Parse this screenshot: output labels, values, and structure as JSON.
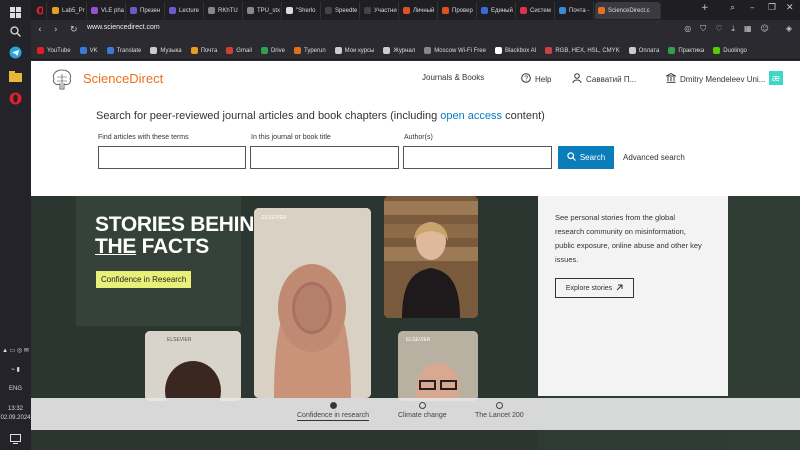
{
  "os": {
    "language": "ENG",
    "time": "13:32",
    "date": "02.09.2024"
  },
  "tabs": [
    {
      "label": "Lab5_Pr",
      "color": "#e0a020"
    },
    {
      "label": "VLE pha",
      "color": "#9a4fd0"
    },
    {
      "label": "Презен",
      "color": "#6a5acd"
    },
    {
      "label": "Lecture",
      "color": "#6a5acd"
    },
    {
      "label": "RKhTU",
      "color": "#888888"
    },
    {
      "label": "TPU_stx",
      "color": "#888888"
    },
    {
      "label": "\"Sherlo",
      "color": "#dddddd"
    },
    {
      "label": "Speedte",
      "color": "#444444"
    },
    {
      "label": "Участни",
      "color": "#444444"
    },
    {
      "label": "Личный",
      "color": "#e05020"
    },
    {
      "label": "Провер",
      "color": "#e05020"
    },
    {
      "label": "Единый",
      "color": "#3a6ad0"
    },
    {
      "label": "Систем",
      "color": "#e03050"
    },
    {
      "label": "Почта -",
      "color": "#3a8ad0"
    },
    {
      "label": "ScienceDirect.c",
      "color": "#e9711c"
    }
  ],
  "address": {
    "url": "www.sciencedirect.com"
  },
  "bookmarks": [
    {
      "label": "YouTube",
      "color": "#e02020"
    },
    {
      "label": "VK",
      "color": "#3a7ad0"
    },
    {
      "label": "Translate",
      "color": "#3a7ad0"
    },
    {
      "label": "Музыка",
      "color": "#cccccc"
    },
    {
      "label": "Почта",
      "color": "#e0a020"
    },
    {
      "label": "Gmail",
      "color": "#d04030"
    },
    {
      "label": "Drive",
      "color": "#30a050"
    },
    {
      "label": "Typerun",
      "color": "#e07020"
    },
    {
      "label": "Мои курсы",
      "color": "#cccccc"
    },
    {
      "label": "Журнал",
      "color": "#cccccc"
    },
    {
      "label": "Moscow Wi-Fi Free",
      "color": "#888888"
    },
    {
      "label": "Blackbox AI",
      "color": "#ffffff"
    },
    {
      "label": "RGB, HEX, HSL, CMYK",
      "color": "#cc4040"
    },
    {
      "label": "Оплата",
      "color": "#cccccc"
    },
    {
      "label": "Практика",
      "color": "#30a050"
    },
    {
      "label": "Duolingo",
      "color": "#58cc02"
    }
  ],
  "header": {
    "logo": "ScienceDirect",
    "journals_books": "Journals & Books",
    "help": "Help",
    "user": "Савватий П...",
    "institution": "Dmitry Mendeleev Uni..."
  },
  "search": {
    "title_before": "Search for peer-reviewed journal articles and book chapters (including ",
    "title_link": "open access",
    "title_after": " content)",
    "label_terms": "Find articles with these terms",
    "label_journal": "In this journal or book title",
    "label_authors": "Author(s)",
    "button": "Search",
    "advanced": "Advanced search"
  },
  "hero": {
    "headline_1": "STORIES BEHIND",
    "headline_the": "THE",
    "headline_facts": "FACTS",
    "badge": "Confidence in Research",
    "info": "See personal stories from the global research community on misinformation, public exposure, online abuse and other key issues.",
    "explore": "Explore stories",
    "photo_label": "ELSEVIER"
  },
  "carousel": [
    {
      "label": "Confidence in research",
      "active": true
    },
    {
      "label": "Climate change",
      "active": false
    },
    {
      "label": "The Lancet 200",
      "active": false
    }
  ],
  "colors": {
    "brand_orange": "#e9711c",
    "link_blue": "#0c7dbb",
    "hero_green": "#2c3630",
    "badge_yellow": "#e8f07a"
  }
}
